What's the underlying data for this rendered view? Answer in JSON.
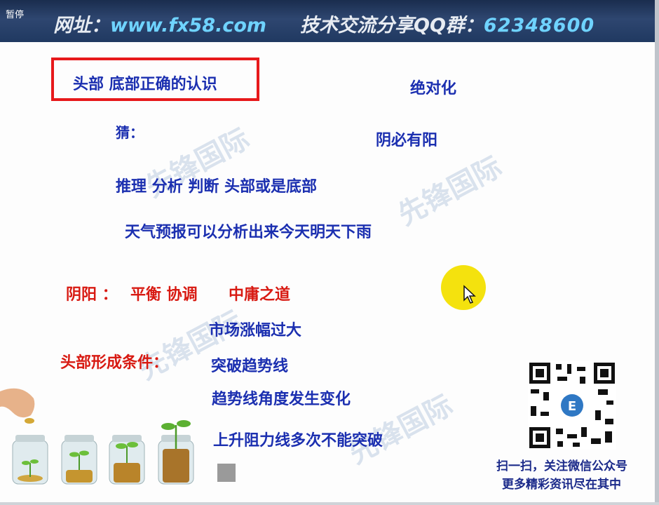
{
  "header": {
    "pause_label": "暂停",
    "site_label": "网址：",
    "site_value": "www.fx58.com",
    "qq_label": "技术交流分享QQ群：",
    "qq_value": "62348600"
  },
  "slide": {
    "title": "头部 底部正确的认识",
    "guess": "猜：",
    "absolute": "绝对化",
    "yin_has_yang": "阴必有阳",
    "reasoning": "推理 分析 判断 头部或是底部",
    "weather": "天气预报可以分析出来今天明天下雨",
    "yinyang_label": "阴阳 ：",
    "balance": "平衡 协调",
    "middle_way": "中庸之道",
    "top_condition_label": "头部形成条件：",
    "conditions": [
      "市场涨幅过大",
      "突破趋势线",
      "趋势线角度发生变化",
      "上升阻力线多次不能突破"
    ]
  },
  "qr": {
    "caption_1": "扫一扫，关注微信公众号",
    "caption_2": "更多精彩资讯尽在其中"
  },
  "colors": {
    "header_bg": "#203961",
    "accent_blue": "#1b2fb0",
    "accent_red": "#d81a12",
    "cursor_highlight": "#f4e20e"
  }
}
